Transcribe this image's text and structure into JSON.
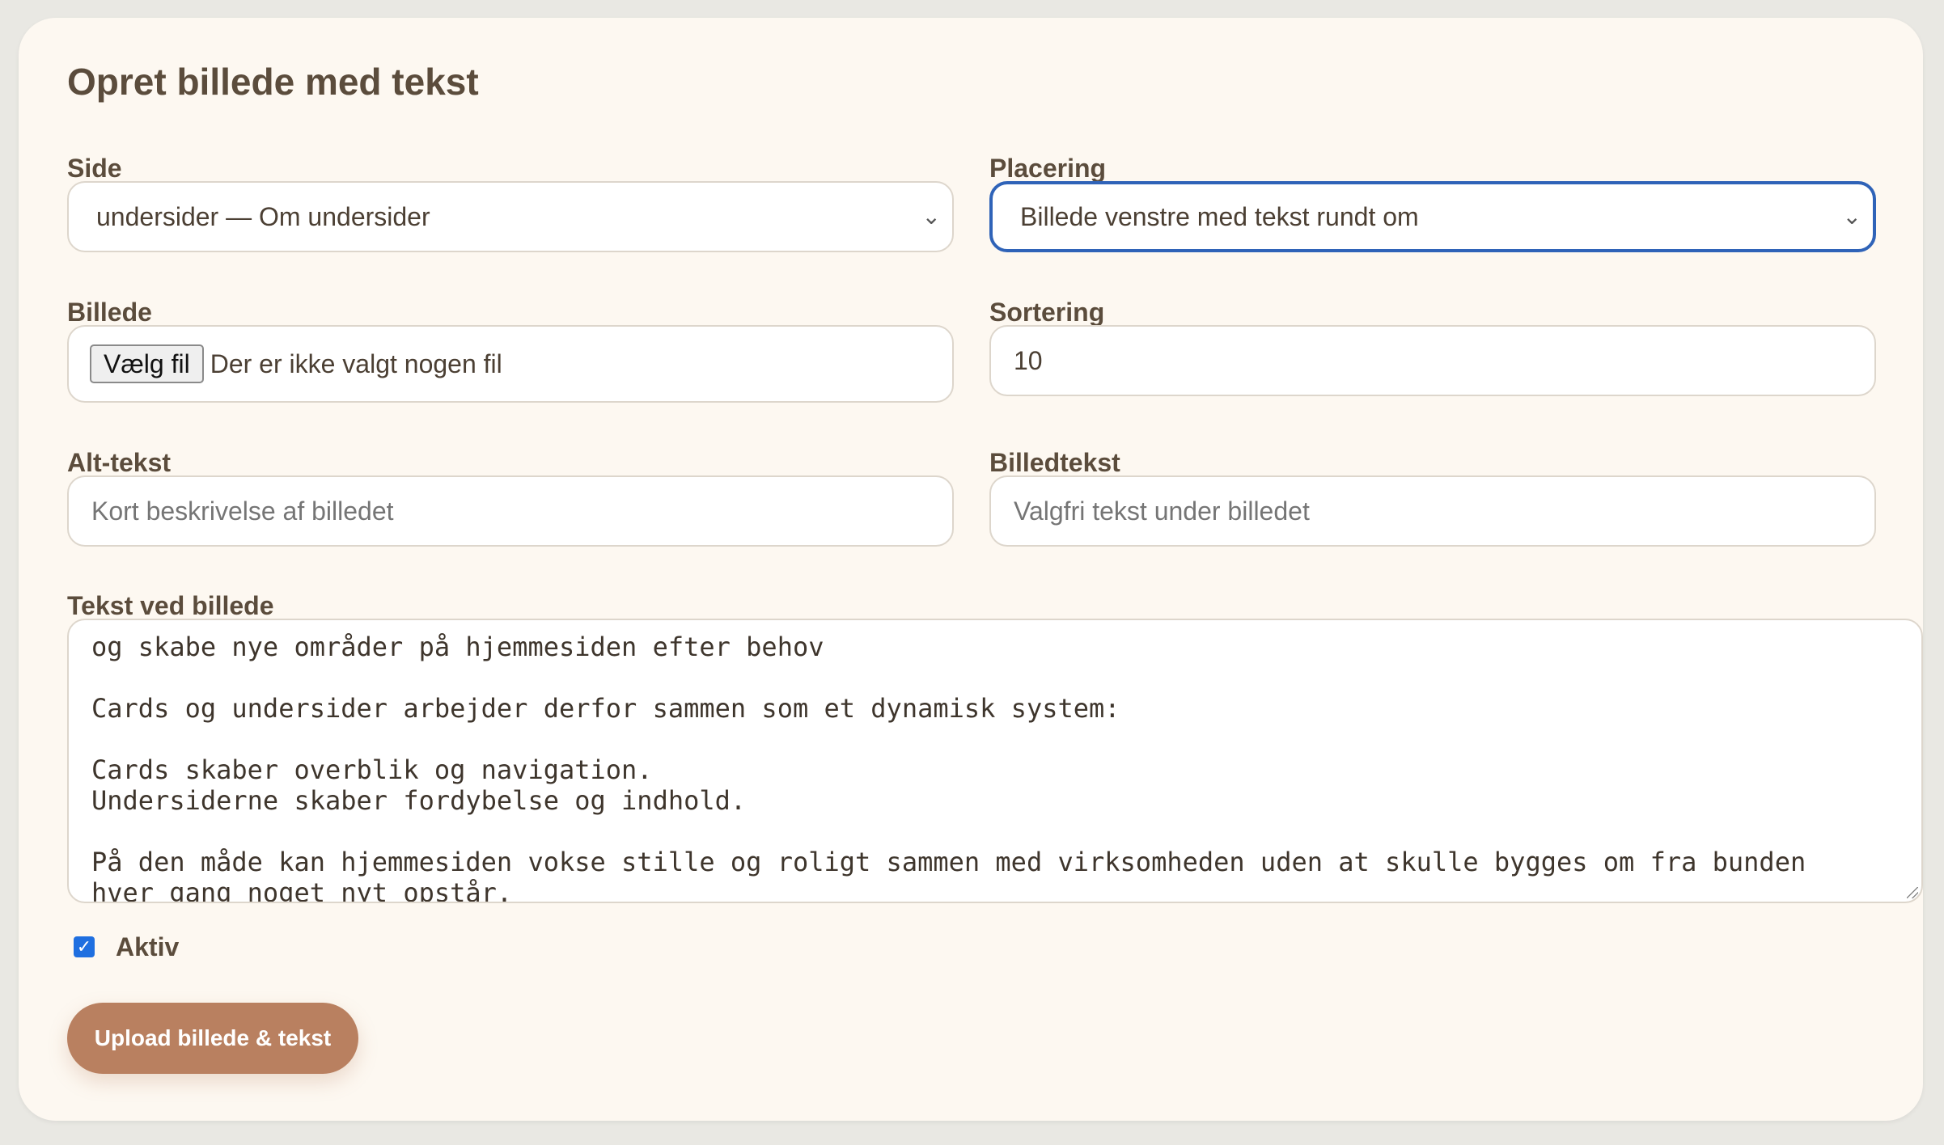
{
  "form": {
    "title": "Opret billede med tekst",
    "side": {
      "label": "Side",
      "selected": "undersider — Om undersider"
    },
    "placering": {
      "label": "Placering",
      "selected": "Billede venstre med tekst rundt om"
    },
    "billede": {
      "label": "Billede",
      "button_label": "Vælg fil",
      "status": "Der er ikke valgt nogen fil"
    },
    "sortering": {
      "label": "Sortering",
      "value": "10"
    },
    "alt_tekst": {
      "label": "Alt-tekst",
      "placeholder": "Kort beskrivelse af billedet"
    },
    "billedtekst": {
      "label": "Billedtekst",
      "placeholder": "Valgfri tekst under billedet"
    },
    "tekst_ved_billede": {
      "label": "Tekst ved billede",
      "lines": [
        "og skabe nye områder på hjemmesiden efter behov",
        "",
        "Cards og undersider arbejder derfor sammen som et dynamisk system:",
        "",
        "Cards skaber overblik og navigation.",
        "Undersiderne skaber fordybelse og indhold.",
        "",
        "På den måde kan hjemmesiden vokse stille og roligt sammen med virksomheden uden at skulle bygges om fra bunden",
        "hver gang noget nyt opstår."
      ]
    },
    "aktiv": {
      "label": "Aktiv",
      "checked": true
    },
    "submit_label": "Upload billede & tekst"
  },
  "colors": {
    "background": "#e9e8e3",
    "card": "#fdf8f1",
    "text": "#5b4c3c",
    "accent_button": "#b98060",
    "focus": "#2f63b8",
    "checkbox": "#1f6fe0"
  }
}
